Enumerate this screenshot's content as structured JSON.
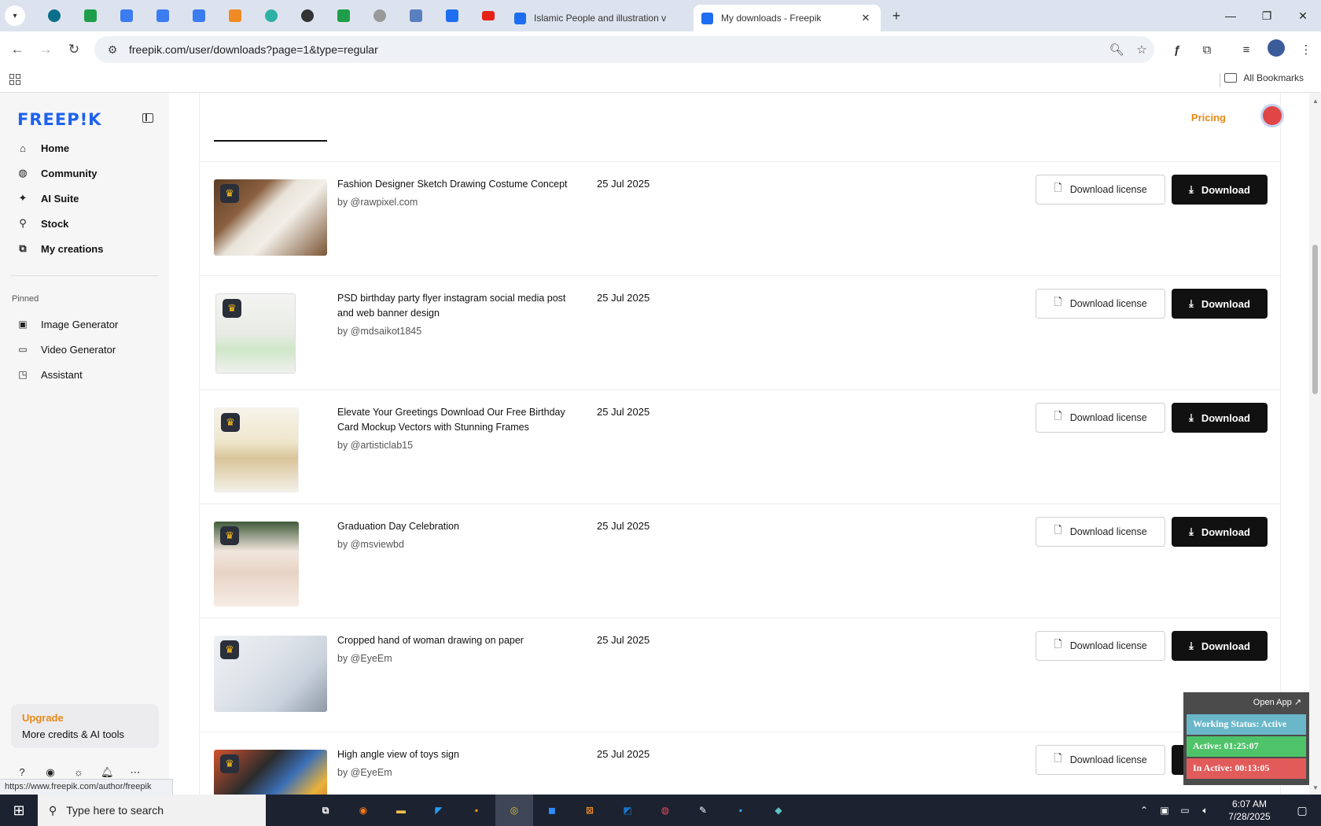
{
  "browser": {
    "tabs": [
      {
        "title": "Islamic People and illustration v",
        "active": false
      },
      {
        "title": "My downloads - Freepik",
        "active": true
      }
    ],
    "url": "freepik.com/user/downloads?page=1&type=regular",
    "all_bookmarks": "All Bookmarks",
    "status_url": "https://www.freepik.com/author/freepik"
  },
  "sidebar": {
    "logo": "FREEP!K",
    "nav": [
      {
        "label": "Home",
        "icon": "home-icon"
      },
      {
        "label": "Community",
        "icon": "globe-icon"
      },
      {
        "label": "AI Suite",
        "icon": "sparkle-icon"
      },
      {
        "label": "Stock",
        "icon": "search-icon"
      },
      {
        "label": "My creations",
        "icon": "stack-icon"
      }
    ],
    "pinned_label": "Pinned",
    "pinned": [
      {
        "label": "Image Generator",
        "icon": "image-icon"
      },
      {
        "label": "Video Generator",
        "icon": "video-icon"
      },
      {
        "label": "Assistant",
        "icon": "chat-icon"
      }
    ],
    "upgrade": {
      "title": "Upgrade",
      "subtitle": "More credits & AI tools"
    }
  },
  "header": {
    "pricing": "Pricing"
  },
  "downloads": {
    "license_label": "Download license",
    "download_label": "Download",
    "items": [
      {
        "title": "Fashion Designer Sketch Drawing Costume Concept",
        "author": "by @rawpixel.com",
        "date": "25 Jul 2025"
      },
      {
        "title": "PSD birthday party flyer instagram social media post and web banner design",
        "author": "by @mdsaikot1845",
        "date": "25 Jul 2025"
      },
      {
        "title": "Elevate Your Greetings Download Our Free Birthday Card Mockup Vectors with Stunning Frames",
        "author": "by @artisticlab15",
        "date": "25 Jul 2025"
      },
      {
        "title": "Graduation Day Celebration",
        "author": "by @msviewbd",
        "date": "25 Jul 2025"
      },
      {
        "title": "Cropped hand of woman drawing on paper",
        "author": "by @EyeEm",
        "date": "25 Jul 2025"
      },
      {
        "title": "High angle view of toys sign",
        "author": "by @EyeEm",
        "date": "25 Jul 2025"
      }
    ]
  },
  "tracker": {
    "open_app": "Open App ↗",
    "working_status": "Working Status: Active",
    "active": "Active: 01:25:07",
    "inactive": "In Active: 00:13:05"
  },
  "taskbar": {
    "search_placeholder": "Type here to search",
    "time": "6:07 AM",
    "date": "7/28/2025"
  },
  "colors": {
    "brand": "#1d62f0",
    "accent_orange": "#e8891a",
    "button_dark": "#111111",
    "tracker_blue": "#6ab7c9",
    "tracker_green": "#4fc36a",
    "tracker_red": "#e25b5b"
  }
}
